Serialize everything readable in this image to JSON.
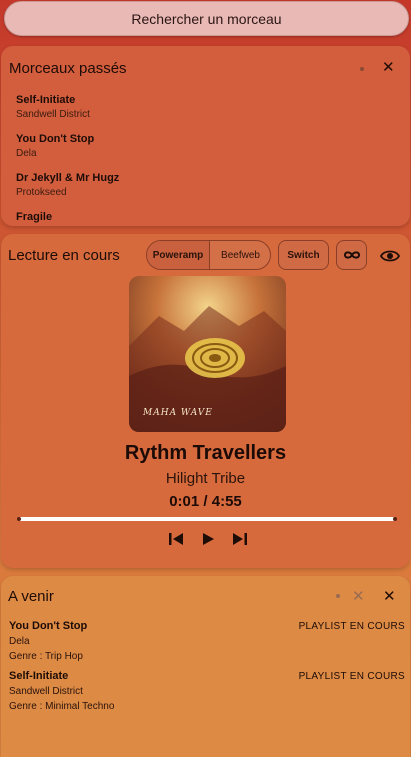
{
  "search": {
    "label": "Rechercher un morceau"
  },
  "history": {
    "title": "Morceaux passés",
    "items": [
      {
        "title": "Self-Initiate",
        "artist": "Sandwell District"
      },
      {
        "title": "You Don't Stop",
        "artist": "Dela"
      },
      {
        "title": "Dr Jekyll & Mr Hugz",
        "artist": "Protokseed"
      },
      {
        "title": "Fragile",
        "artist": ""
      }
    ]
  },
  "now_playing": {
    "title": "Lecture en cours",
    "sources": {
      "active": "Poweramp",
      "other": "Beefweb"
    },
    "switch_label": "Switch",
    "cover_text": "MAHA WAVE",
    "track_title": "Rythm Travellers",
    "track_artist": "Hilight Tribe",
    "time": "0:01 / 4:55",
    "progress": 0.995
  },
  "upcoming": {
    "title": "A venir",
    "items": [
      {
        "title": "You Don't Stop",
        "artist": "Dela",
        "genre": "Genre : Trip Hop",
        "source": "PLAYLIST EN COURS"
      },
      {
        "title": "Self-Initiate",
        "artist": "Sandwell District",
        "genre": "Genre : Minimal Techno",
        "source": "PLAYLIST EN COURS"
      }
    ]
  },
  "icons": {
    "close": "close-icon",
    "eye": "eye-icon",
    "infinity": "infinity-icon",
    "prev": "skip-previous-icon",
    "play": "play-icon",
    "next": "skip-next-icon"
  }
}
